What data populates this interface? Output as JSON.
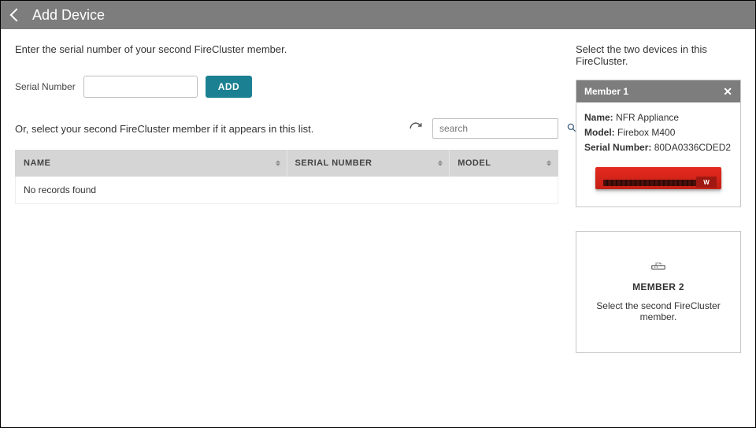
{
  "header": {
    "title": "Add Device"
  },
  "main": {
    "enter_instruction": "Enter the serial number of your second FireCluster member.",
    "serial_label": "Serial Number",
    "serial_value": "",
    "add_button": "ADD",
    "or_instruction": "Or, select your second FireCluster member if it appears in this list.",
    "search_placeholder": "search",
    "table": {
      "columns": {
        "name": "NAME",
        "serial": "SERIAL NUMBER",
        "model": "MODEL"
      },
      "empty_text": "No records found"
    }
  },
  "right": {
    "instruction": "Select the two devices in this FireCluster.",
    "member1": {
      "title": "Member 1",
      "name_label": "Name:",
      "name_value": "NFR Appliance",
      "model_label": "Model:",
      "model_value": "Firebox M400",
      "serial_label": "Serial Number:",
      "serial_value": "80DA0336CDED2"
    },
    "member2": {
      "title": "MEMBER 2",
      "instruction": "Select the second FireCluster member."
    }
  }
}
